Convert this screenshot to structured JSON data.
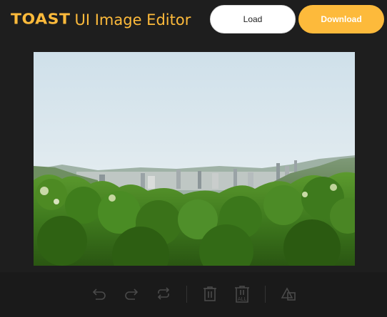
{
  "header": {
    "logo_brand": "TOAST",
    "logo_rest": "UI Image Editor",
    "load_label": "Load",
    "download_label": "Download"
  },
  "colors": {
    "accent": "#fdba3b",
    "background": "#1e1e1e",
    "icon": "#4a4a4a"
  },
  "toolbar": {
    "items": [
      {
        "name": "undo-icon"
      },
      {
        "name": "redo-icon"
      },
      {
        "name": "reset-icon"
      },
      {
        "name": "delete-icon"
      },
      {
        "name": "delete-all-icon",
        "label": "ALL"
      },
      {
        "name": "shape-icon"
      }
    ]
  },
  "canvas": {
    "image_description_icon": "landscape-photo"
  }
}
